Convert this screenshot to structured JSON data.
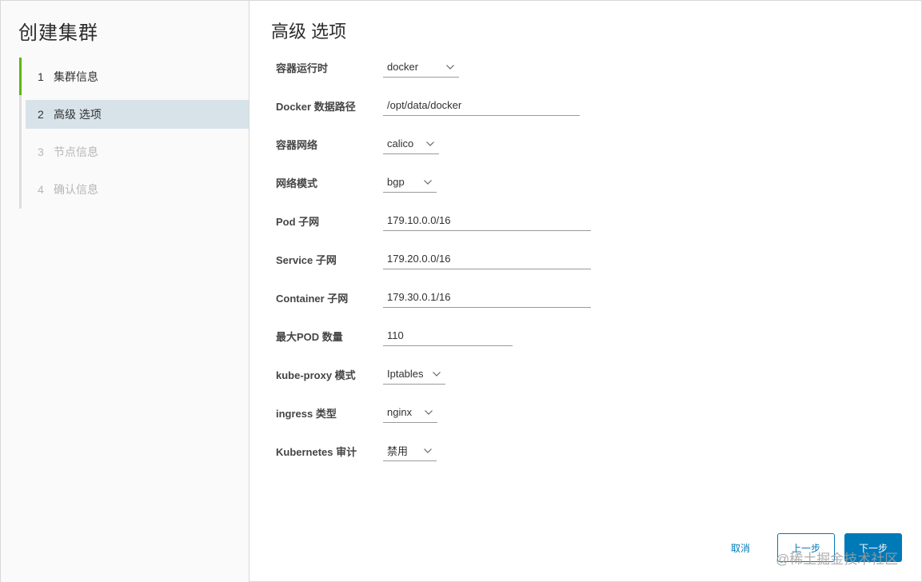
{
  "wizard": {
    "title": "创建集群",
    "steps": [
      {
        "num": "1",
        "label": "集群信息",
        "state": "done"
      },
      {
        "num": "2",
        "label": "高级 选项",
        "state": "active"
      },
      {
        "num": "3",
        "label": "节点信息",
        "state": "pending"
      },
      {
        "num": "4",
        "label": "确认信息",
        "state": "pending"
      }
    ]
  },
  "page": {
    "title": "高级 选项"
  },
  "form": {
    "container_runtime": {
      "label": "容器运行时",
      "value": "docker"
    },
    "docker_path": {
      "label": "Docker 数据路径",
      "value": "/opt/data/docker"
    },
    "container_network": {
      "label": "容器网络",
      "value": "calico"
    },
    "network_mode": {
      "label": "网络模式",
      "value": "bgp"
    },
    "pod_subnet": {
      "label": "Pod 子网",
      "value": "179.10.0.0/16"
    },
    "service_subnet": {
      "label": "Service 子网",
      "value": "179.20.0.0/16"
    },
    "container_subnet": {
      "label": "Container 子网",
      "value": "179.30.0.1/16"
    },
    "max_pods": {
      "label": "最大POD 数量",
      "value": "110"
    },
    "kube_proxy_mode": {
      "label": "kube-proxy 模式",
      "value": "Iptables"
    },
    "ingress_type": {
      "label": "ingress 类型",
      "value": "nginx"
    },
    "k8s_audit": {
      "label": "Kubernetes 审计",
      "value": "禁用"
    }
  },
  "footer": {
    "cancel_label": "取消",
    "prev_label": "上一步",
    "next_label": "下一步"
  },
  "watermark": "@稀土掘金技术社区",
  "colors": {
    "accent": "#0079b8",
    "step_done": "#60b515",
    "step_active_bg": "#d8e3e9",
    "sidebar_bg": "#fafafa"
  }
}
